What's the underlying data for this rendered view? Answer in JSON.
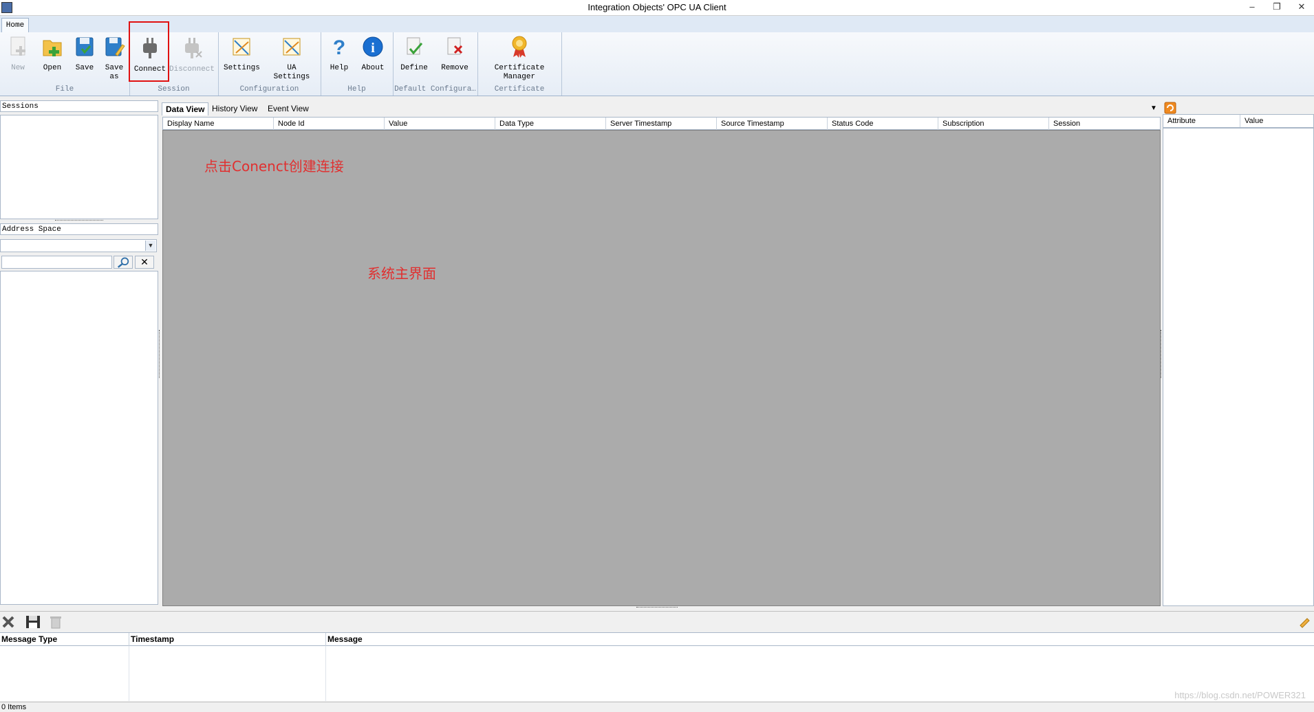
{
  "window": {
    "title": "Integration Objects' OPC UA Client",
    "minimize": "–",
    "maximize": "❐",
    "close": "✕"
  },
  "ribbon": {
    "tab": "Home",
    "groups": {
      "file": "File",
      "session": "Session",
      "configuration": "Configuration",
      "help": "Help",
      "default_config": "Default Configura…",
      "certificate": "Certificate"
    },
    "buttons": {
      "new": "New",
      "open": "Open",
      "save": "Save",
      "save_as": "Save as",
      "connect": "Connect",
      "disconnect": "Disconnect",
      "settings": "Settings",
      "ua_settings": "UA Settings",
      "help": "Help",
      "about": "About",
      "define": "Define",
      "remove": "Remove",
      "certificate_manager": "Certificate Manager"
    }
  },
  "left": {
    "sessions_header": "Sessions",
    "address_space_header": "Address Space",
    "search_value": "",
    "dropdown_value": ""
  },
  "center": {
    "tabs": [
      "Data View",
      "History View",
      "Event View"
    ],
    "columns": [
      "Display Name",
      "Node Id",
      "Value",
      "Data Type",
      "Server Timestamp",
      "Source Timestamp",
      "Status Code",
      "Subscription",
      "Session"
    ],
    "annotation_connect": "点击Conenct创建连接",
    "annotation_main": "系统主界面"
  },
  "right": {
    "columns": [
      "Attribute",
      "Value"
    ]
  },
  "log": {
    "columns": [
      "Message Type",
      "Timestamp",
      "Message"
    ]
  },
  "status": {
    "items": "0 Items"
  },
  "watermark": "https://blog.csdn.net/POWER321",
  "colors": {
    "annotation": "#e03030",
    "highlight_box": "#e01010",
    "grid_background": "#ababab"
  }
}
